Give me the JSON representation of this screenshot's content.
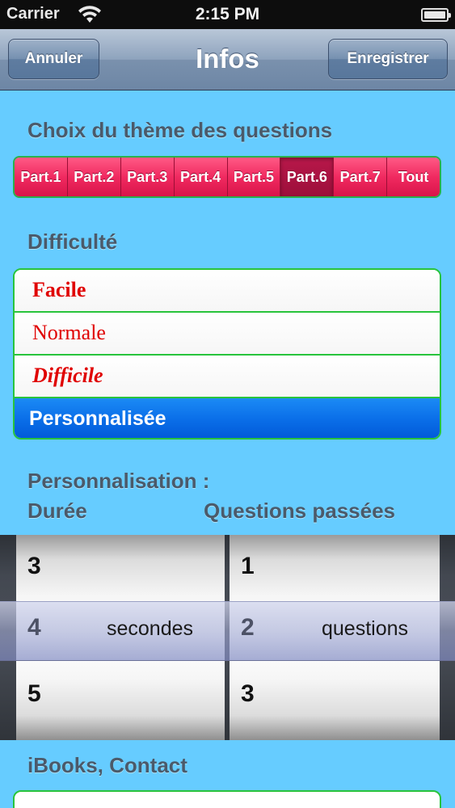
{
  "status_bar": {
    "carrier": "Carrier",
    "time": "2:15 PM"
  },
  "nav": {
    "title": "Infos",
    "cancel_label": "Annuler",
    "save_label": "Enregistrer"
  },
  "theme_section": {
    "title": "Choix du thème des questions",
    "segments": [
      "Part.1",
      "Part.2",
      "Part.3",
      "Part.4",
      "Part.5",
      "Part.6",
      "Part.7",
      "Tout"
    ],
    "selected": "Part.6",
    "accent_color": "#f02a60"
  },
  "difficulty_section": {
    "title": "Difficulté",
    "items": [
      "Facile",
      "Normale",
      "Difficile",
      "Personnalisée"
    ],
    "selected": "Personnalisée",
    "text_color": "#e00000",
    "selected_color": "#0a6ee8"
  },
  "custom_section": {
    "title": "Personnalisation :",
    "duration_label": "Durée",
    "questions_label": "Questions passées"
  },
  "picker": {
    "duration": {
      "values": [
        "3",
        "4",
        "5"
      ],
      "selected": "4",
      "unit": "secondes"
    },
    "questions": {
      "values": [
        "1",
        "2",
        "3"
      ],
      "selected": "2",
      "unit": "questions"
    }
  },
  "footer_section": {
    "title": "iBooks, Contact"
  }
}
